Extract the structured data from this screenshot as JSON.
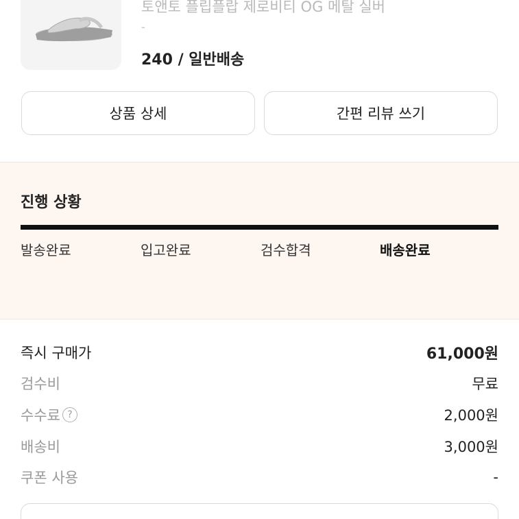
{
  "product": {
    "name": "토앤토 플립플랍 제로비티 OG 메탈 실버",
    "sub": "-",
    "option": "240 / 일반배송"
  },
  "actions": {
    "detail_label": "상품 상세",
    "review_label": "간편 리뷰 쓰기"
  },
  "progress": {
    "title": "진행 상황",
    "completed_fraction": 1.0,
    "steps": [
      {
        "label": "발송완료"
      },
      {
        "label": "입고완료"
      },
      {
        "label": "검수합격"
      },
      {
        "label": "배송완료"
      }
    ]
  },
  "price": {
    "rows": [
      {
        "label": "즉시 구매가",
        "value": "61,000원"
      },
      {
        "label": "검수비",
        "value": "무료"
      },
      {
        "label": "수수료",
        "value": "2,000원"
      },
      {
        "label": "배송비",
        "value": "3,000원"
      },
      {
        "label": "쿠폰 사용",
        "value": "-"
      }
    ],
    "help_icon": "question-circle-icon"
  },
  "colors": {
    "progress_background": "#fdf6f1",
    "progress_fill": "#111111",
    "muted_text": "#9a9a9a"
  }
}
